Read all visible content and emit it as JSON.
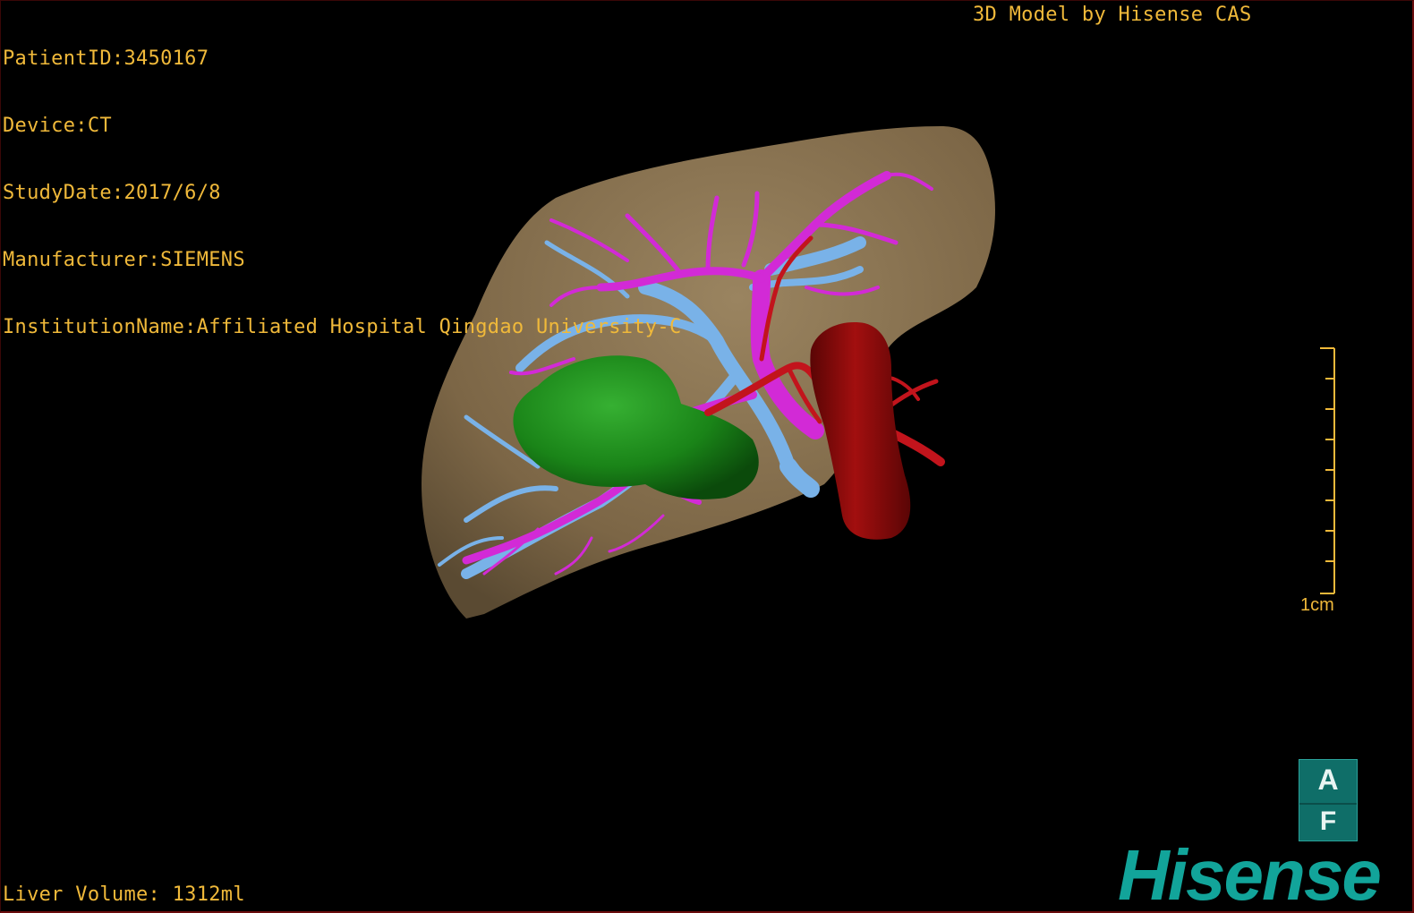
{
  "dicom_info": {
    "patient_id": "PatientID:3450167",
    "device": "Device:CT",
    "study_date": "StudyDate:2017/6/8",
    "manufacturer": "Manufacturer:SIEMENS",
    "institution": "InstitutionName:Affiliated Hospital Qingdao University-C"
  },
  "model_credit": "3D Model by Hisense CAS",
  "liver_volume": "Liver Volume: 1312ml",
  "scale": {
    "label": "1cm"
  },
  "orientation": {
    "top": "A",
    "bottom": "F"
  },
  "brand": "Hisense",
  "colors": {
    "text": "#f0b93a",
    "liver": "#8a7350",
    "portal_vein": "#d22ad6",
    "hepatic_vein": "#79b2e8",
    "tumor": "#1c8a1c",
    "ivc": "#9a0b0b",
    "artery": "#c2141c",
    "brand": "#12a49a"
  }
}
